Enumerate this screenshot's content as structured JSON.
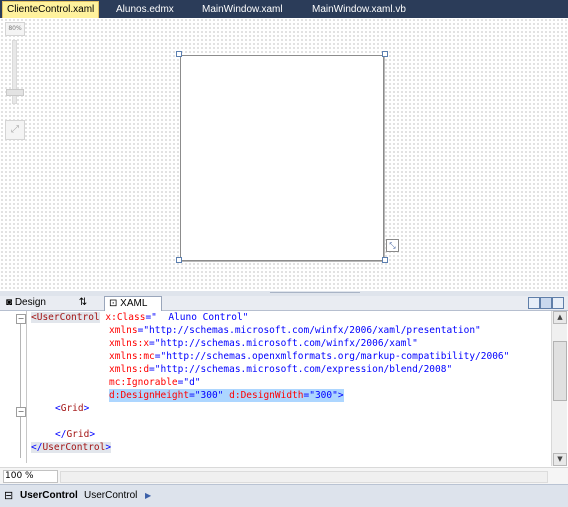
{
  "document_tabs": [
    {
      "label": "ClienteControl.xaml",
      "active": true
    },
    {
      "label": "Alunos.edmx",
      "active": false
    },
    {
      "label": "MainWindow.xaml",
      "active": false
    },
    {
      "label": "MainWindow.xaml.vb",
      "active": false
    }
  ],
  "designer": {
    "zoom_label": "80%",
    "zoom_level_fraction": 0.18
  },
  "view_tabs": {
    "design_label": "Design",
    "swap_label": "⇅",
    "xaml_label": "XAML"
  },
  "code_lines": [
    {
      "parts": [
        [
          "tag",
          "<"
        ],
        [
          "tag",
          "UserControl"
        ],
        [
          "plain",
          " "
        ],
        [
          "attr",
          "x:Class"
        ],
        [
          "val",
          "=\"  Aluno Control\""
        ]
      ]
    },
    {
      "parts": [
        [
          "attr",
          "xmlns"
        ],
        [
          "val",
          "=\"http://schemas.microsoft.com/winfx/2006/xaml/presentation\""
        ]
      ]
    },
    {
      "parts": [
        [
          "attr",
          "xmlns:x"
        ],
        [
          "val",
          "=\"http://schemas.microsoft.com/winfx/2006/xaml\""
        ]
      ]
    },
    {
      "parts": [
        [
          "attr",
          "xmlns:mc"
        ],
        [
          "val",
          "=\"http://schemas.openxmlformats.org/markup-compatibility/2006\""
        ]
      ]
    },
    {
      "parts": [
        [
          "attr",
          "xmlns:d"
        ],
        [
          "val",
          "=\"http://schemas.microsoft.com/expression/blend/2008\""
        ]
      ]
    },
    {
      "parts": [
        [
          "attr",
          "mc:Ignorable"
        ],
        [
          "val",
          "=\"d\""
        ]
      ]
    },
    {
      "parts": [
        [
          "attr",
          "d:DesignHeight"
        ],
        [
          "val",
          "=\"300\""
        ],
        [
          "plain",
          " "
        ],
        [
          "attr",
          "d:DesignWidth"
        ],
        [
          "val",
          "=\"300\""
        ],
        [
          "tagb",
          ">"
        ]
      ]
    },
    {
      "parts": [
        [
          "tagb",
          "<"
        ],
        [
          "tag",
          "Grid"
        ],
        [
          "tagb",
          ">"
        ]
      ]
    },
    {
      "parts": []
    },
    {
      "parts": [
        [
          "tagb",
          "</"
        ],
        [
          "tag",
          "Grid"
        ],
        [
          "tagb",
          ">"
        ]
      ]
    },
    {
      "parts": [
        [
          "tagb",
          "</"
        ],
        [
          "tag",
          "UserControl"
        ],
        [
          "tagb",
          ">"
        ]
      ]
    }
  ],
  "editor_zoom": "100 %",
  "breadcrumb": {
    "root": "UserControl",
    "item": "UserControl",
    "arrow": "▶"
  },
  "colors": {
    "tab_strip": "#2b3c59",
    "active_tab": "#fff29d",
    "selection": "#add6ff"
  },
  "icons": {
    "fit_button": "fit-to-screen-icon",
    "resize": "resize-icon",
    "breadcrumb_root": "document-outline-icon"
  }
}
